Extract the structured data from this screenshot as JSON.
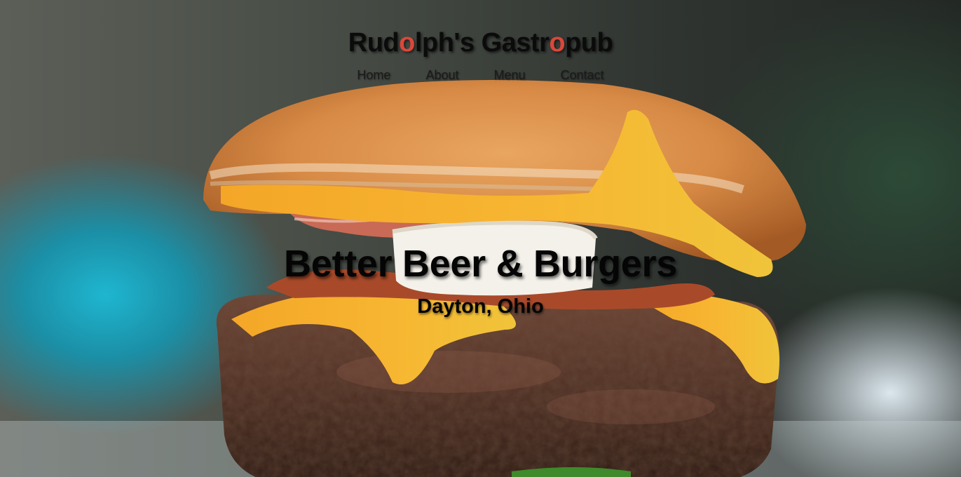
{
  "brand": {
    "name_parts": [
      "Rud",
      "o",
      "lph's Gastr",
      "o",
      "pub"
    ],
    "accent_color": "#d9483b"
  },
  "nav": {
    "items": [
      {
        "label": "Home"
      },
      {
        "label": "About"
      },
      {
        "label": "Menu"
      },
      {
        "label": "Contact"
      }
    ]
  },
  "hero": {
    "title": "Better Beer & Burgers",
    "subtitle": "Dayton, Ohio",
    "background_image": "burger-photo"
  }
}
